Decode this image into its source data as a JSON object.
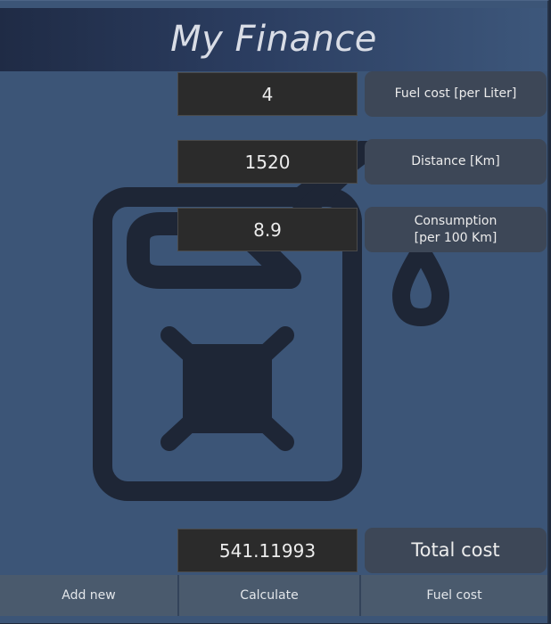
{
  "header": {
    "title": "My Finance"
  },
  "fields": {
    "fuel_cost": {
      "value": "4",
      "label": "Fuel cost [per Liter]"
    },
    "distance": {
      "value": "1520",
      "label": "Distance [Km]"
    },
    "consumption": {
      "value": "8.9",
      "label": "Consumption\n [per 100 Km]"
    }
  },
  "result": {
    "value": "541.11993",
    "label": "Total cost"
  },
  "nav": {
    "add_new": "Add new",
    "calculate": "Calculate",
    "fuel_cost": "Fuel cost"
  },
  "icons": {
    "background": "fuel-can-icon"
  },
  "colors": {
    "background": "#3c5577",
    "field": "#2b2b2b",
    "label": "#3d4757",
    "nav": "#4a5a6d"
  }
}
